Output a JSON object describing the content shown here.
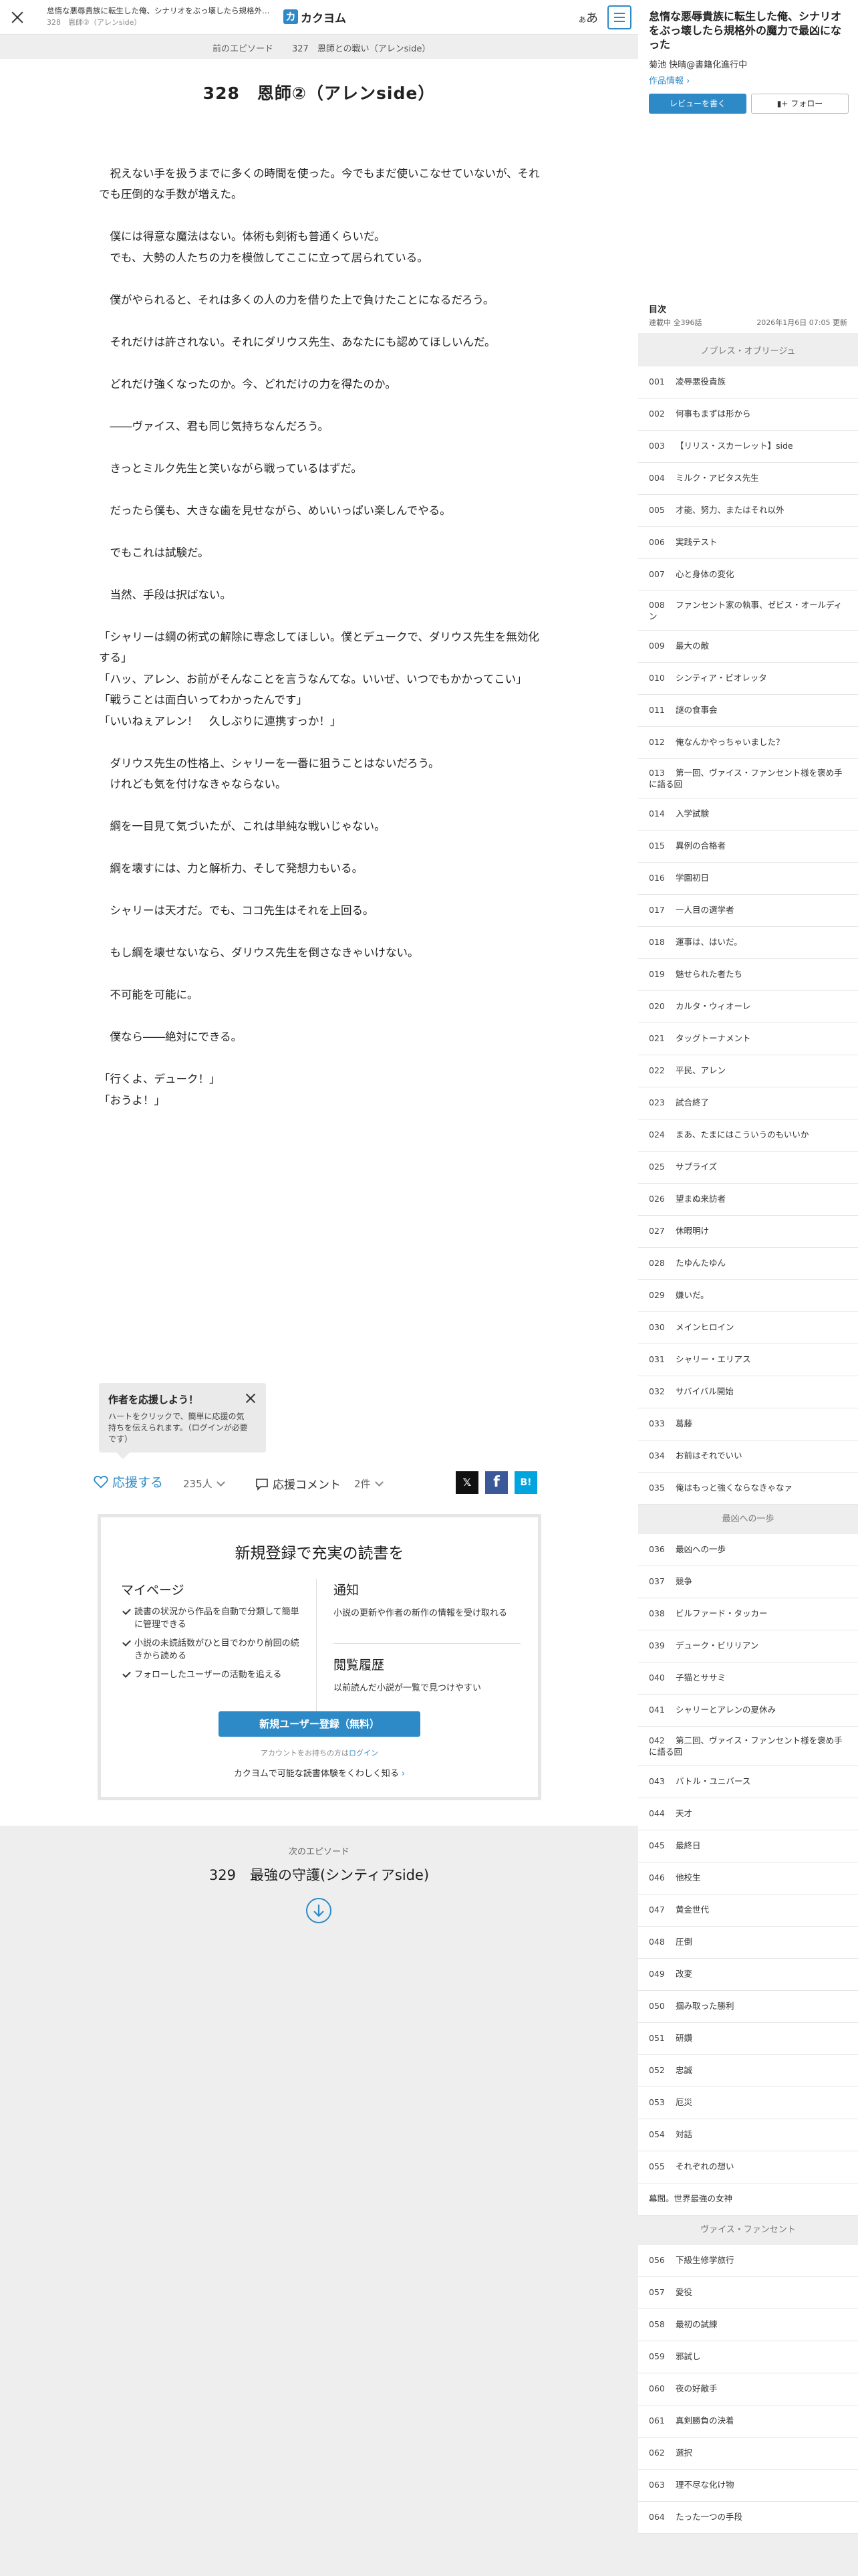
{
  "header": {
    "work_title": "怠惰な悪辱貴族に転生した俺、シナリオをぶっ壊したら規格外の魔力で最凶になった",
    "episode_sub": "328　恩師②（アレンside）",
    "logo_mark": "カ",
    "logo_text": "カクヨム",
    "font_toggle_small": "あ",
    "font_toggle_big": "あ"
  },
  "episode_nav": {
    "prev_label": "前のエピソード",
    "current_label": "327　恩師との戦い（アレンside）"
  },
  "episode": {
    "title": "328　恩師②（アレンside）",
    "paragraphs": [
      "",
      "　祝えない手を扱うまでに多くの時間を使った。今でもまだ使いこなせていないが、それでも圧倒的な手数が増えた。",
      "",
      "　僕には得意な魔法はない。体術も剣術も普通くらいだ。",
      "　でも、大勢の人たちの力を模倣してここに立って居られている。",
      "",
      "　僕がやられると、それは多くの人の力を借りた上で負けたことになるだろう。",
      "",
      "　それだけは許されない。それにダリウス先生、あなたにも認めてほしいんだ。",
      "",
      "　どれだけ強くなったのか。今、どれだけの力を得たのか。",
      "",
      "　――ヴァイス、君も同じ気持ちなんだろう。",
      "",
      "　きっとミルク先生と笑いながら戦っているはずだ。",
      "",
      "　だったら僕も、大きな歯を見せながら、めいいっぱい楽しんでやる。",
      "",
      "　でもこれは試験だ。",
      "",
      "　当然、手段は択ばない。",
      "",
      "「シャリーは綱の術式の解除に専念してほしい。僕とデュークで、ダリウス先生を無効化する」",
      "「ハッ、アレン、お前がそんなことを言うなんてな。いいぜ、いつでもかかってこい」",
      "「戦うことは面白いってわかったんです」",
      "「いいねぇアレン！　久しぶりに連携すっか！」",
      "",
      "　ダリウス先生の性格上、シャリーを一番に狙うことはないだろう。",
      "　けれども気を付けなきゃならない。",
      "",
      "　綱を一目見て気づいたが、これは単純な戦いじゃない。",
      "",
      "　綱を壊すには、力と解析力、そして発想力もいる。",
      "",
      "　シャリーは天才だ。でも、ココ先生はそれを上回る。",
      "",
      "　もし綱を壊せないなら、ダリウス先生を倒さなきゃいけない。",
      "",
      "　不可能を可能に。",
      "",
      "　僕なら――絶対にできる。",
      "",
      "「行くよ、デューク！」",
      "「おうよ！」"
    ]
  },
  "cheer_popup": {
    "title": "作者を応援しよう！",
    "description": "ハートをクリックで、簡単に応援の気持ちを伝えられます。（ログインが必要です）"
  },
  "actions": {
    "cheer_label": "応援する",
    "cheer_count": "235人",
    "comment_label": "応援コメント",
    "comment_count": "2件",
    "share_x": "𝕏",
    "share_facebook": "f",
    "share_hatena": "B!"
  },
  "register": {
    "title": "新規登録で充実の読書を",
    "mypage_heading": "マイページ",
    "mypage_items": [
      "読書の状況から作品を自動で分類して簡単に管理できる",
      "小説の未読話数がひと目でわかり前回の続きから読める",
      "フォローしたユーザーの活動を追える"
    ],
    "notify_heading": "通知",
    "notify_desc": "小説の更新や作者の新作の情報を受け取れる",
    "history_heading": "閲覧履歴",
    "history_desc": "以前読んだ小説が一覧で見つけやすい",
    "button_label": "新規ユーザー登録（無料）",
    "login_prefix": "アカウントをお持ちの方は",
    "login_link": "ログイン",
    "learn_more": "カクヨムで可能な読書体験をくわしく知る",
    "learn_more_arrow": "›"
  },
  "next_episode": {
    "label": "次のエピソード",
    "title": "329　最強の守護(シンティアside)"
  },
  "sidebar": {
    "work_title": "怠惰な悪辱貴族に転生した俺、シナリオをぶっ壊したら規格外の魔力で最凶になった",
    "author": "菊池 快晴@書籍化進行中",
    "info_link": "作品情報 ›",
    "review_button": "レビューを書く",
    "follow_button": "フォロー",
    "toc_heading": "目次",
    "toc_count": "連載中 全396話",
    "toc_updated": "2026年1月6日 07:05 更新",
    "chapters": [
      {
        "title": "ノブレス・オブリージュ",
        "episodes": [
          {
            "num": "001",
            "title": "凌辱悪役貴族"
          },
          {
            "num": "002",
            "title": "何事もまずは形から"
          },
          {
            "num": "003",
            "title": "【リリス・スカーレット】side"
          },
          {
            "num": "004",
            "title": "ミルク・アビタス先生"
          },
          {
            "num": "005",
            "title": "才能、努力、またはそれ以外"
          },
          {
            "num": "006",
            "title": "実践テスト"
          },
          {
            "num": "007",
            "title": "心と身体の変化"
          },
          {
            "num": "008",
            "title": "ファンセント家の執事、ゼビス・オールディン"
          },
          {
            "num": "009",
            "title": "最大の敵"
          },
          {
            "num": "010",
            "title": "シンティア・ビオレッタ"
          },
          {
            "num": "011",
            "title": "謎の食事会"
          },
          {
            "num": "012",
            "title": "俺なんかやっちゃいました？"
          },
          {
            "num": "013",
            "title": "第一回、ヴァイス・ファンセント様を褒め手に語る回"
          },
          {
            "num": "014",
            "title": "入学試験"
          },
          {
            "num": "015",
            "title": "異例の合格者"
          },
          {
            "num": "016",
            "title": "学園初日"
          },
          {
            "num": "017",
            "title": "一人目の選学者"
          },
          {
            "num": "018",
            "title": "運事は、はいだ。"
          },
          {
            "num": "019",
            "title": "魅せられた者たち"
          },
          {
            "num": "020",
            "title": "カルタ・ウィオーレ"
          },
          {
            "num": "021",
            "title": "タッグトーナメント"
          },
          {
            "num": "022",
            "title": "平民、アレン"
          },
          {
            "num": "023",
            "title": "試合終了"
          },
          {
            "num": "024",
            "title": "まあ、たまにはこういうのもいいか"
          },
          {
            "num": "025",
            "title": "サプライズ"
          },
          {
            "num": "026",
            "title": "望まぬ来訪者"
          },
          {
            "num": "027",
            "title": "休暇明け"
          },
          {
            "num": "028",
            "title": "たゆんたゆん"
          },
          {
            "num": "029",
            "title": "嫌いだ。"
          },
          {
            "num": "030",
            "title": "メインヒロイン"
          },
          {
            "num": "031",
            "title": "シャリー・エリアス"
          },
          {
            "num": "032",
            "title": "サバイバル開始"
          },
          {
            "num": "033",
            "title": "葛藤"
          },
          {
            "num": "034",
            "title": "お前はそれでいい"
          },
          {
            "num": "035",
            "title": "俺はもっと強くならなきゃなァ"
          }
        ]
      },
      {
        "title": "最凶への一歩",
        "episodes": [
          {
            "num": "036",
            "title": "最凶への一歩"
          },
          {
            "num": "037",
            "title": "競争"
          },
          {
            "num": "038",
            "title": "ビルファード・タッカー"
          },
          {
            "num": "039",
            "title": "デューク・ビリリアン"
          },
          {
            "num": "040",
            "title": "子猫とササミ"
          },
          {
            "num": "041",
            "title": "シャリーとアレンの夏休み"
          },
          {
            "num": "042",
            "title": "第二回、ヴァイス・ファンセント様を褒め手に語る回"
          },
          {
            "num": "043",
            "title": "バトル・ユニバース"
          },
          {
            "num": "044",
            "title": "天才"
          },
          {
            "num": "045",
            "title": "最終日"
          },
          {
            "num": "046",
            "title": "他校生"
          },
          {
            "num": "047",
            "title": "黄金世代"
          },
          {
            "num": "048",
            "title": "圧倒"
          },
          {
            "num": "049",
            "title": "改変"
          },
          {
            "num": "050",
            "title": "掴み取った勝利"
          },
          {
            "num": "051",
            "title": "研鑽"
          },
          {
            "num": "052",
            "title": "忠誠"
          },
          {
            "num": "053",
            "title": "厄災"
          },
          {
            "num": "054",
            "title": "対話"
          },
          {
            "num": "055",
            "title": "それぞれの想い"
          },
          {
            "num": "",
            "title": "幕間。世界最強の女神"
          }
        ]
      },
      {
        "title": "ヴァイス・ファンセント",
        "episodes": [
          {
            "num": "056",
            "title": "下級生修学旅行"
          },
          {
            "num": "057",
            "title": "愛役"
          },
          {
            "num": "058",
            "title": "最初の試練"
          },
          {
            "num": "059",
            "title": "邪試し"
          },
          {
            "num": "060",
            "title": "夜の好敵手"
          },
          {
            "num": "061",
            "title": "真剣勝負の決着"
          },
          {
            "num": "062",
            "title": "選択"
          },
          {
            "num": "063",
            "title": "理不尽な化け物"
          },
          {
            "num": "064",
            "title": "たった一つの手段"
          }
        ]
      }
    ]
  }
}
